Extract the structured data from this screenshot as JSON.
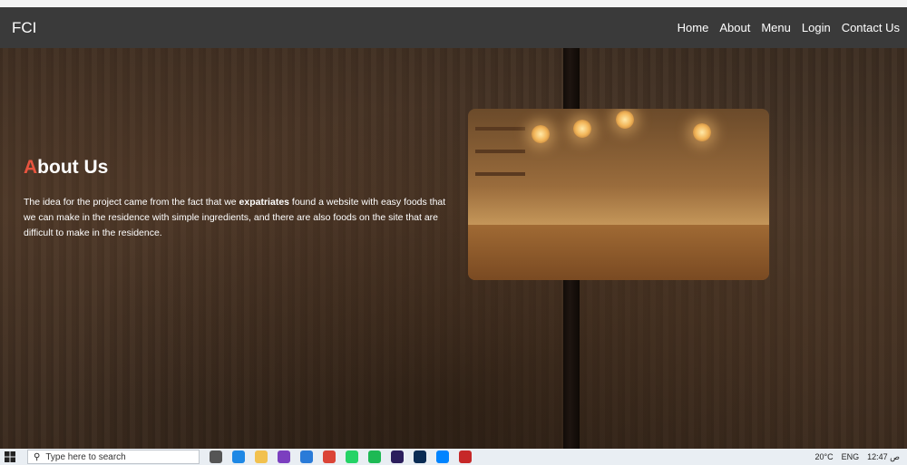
{
  "navbar": {
    "brand": "FCI",
    "links": [
      "Home",
      "About",
      "Menu",
      "Login",
      "Contact Us"
    ]
  },
  "about": {
    "title_accent": "A",
    "title_rest": "bout Us",
    "text_before": "The idea for the project came from the fact that we ",
    "text_bold": "expatriates",
    "text_after": " found a website with easy foods that we can make in the residence with simple ingredients, and there are also foods on the site that are difficult to make in the residence."
  },
  "taskbar": {
    "search_placeholder": "Type here to search",
    "temperature": "20°C",
    "language": "ENG",
    "time": "12:47 ص"
  },
  "colors": {
    "accent": "#e8543f",
    "navbar_bg": "#3a3a3a",
    "scroll_top": "#d8881e"
  }
}
